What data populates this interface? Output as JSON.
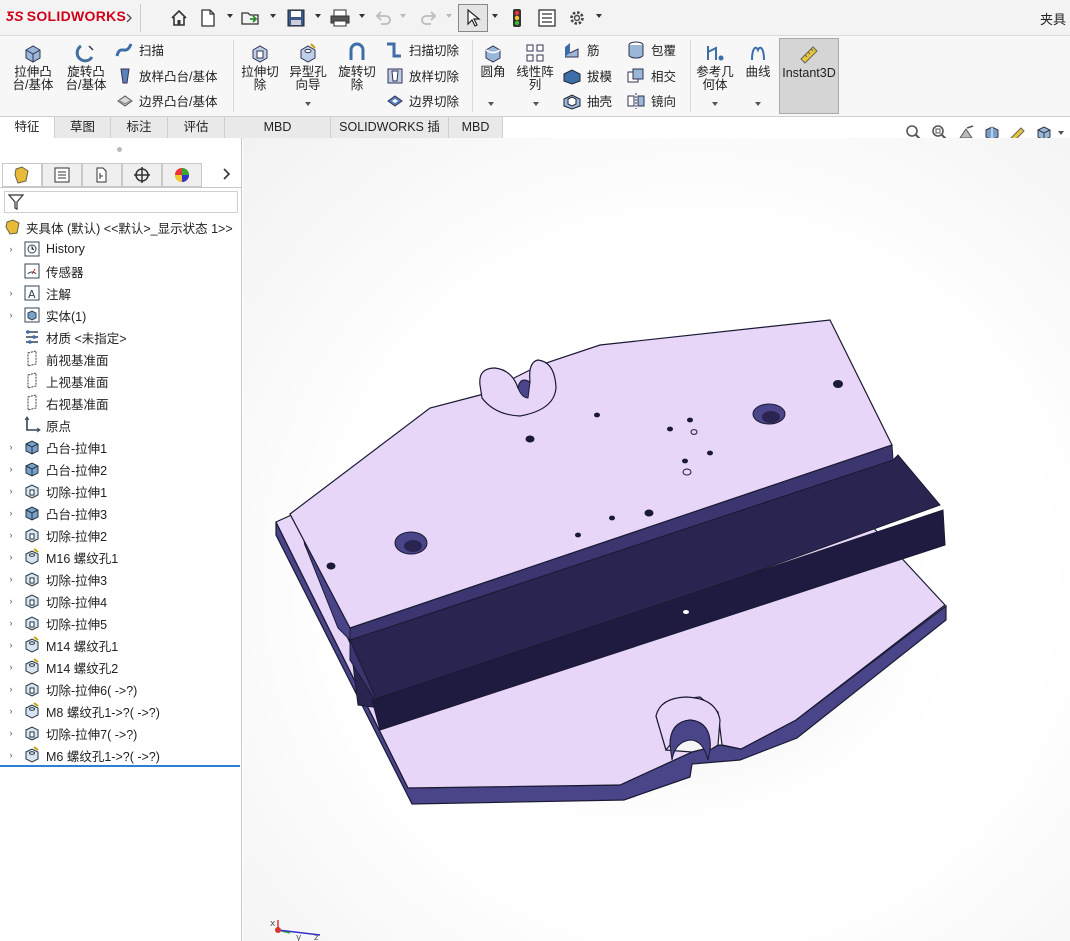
{
  "app": {
    "logo_ds": "ƼS",
    "logo_name": "SOLIDWORKS",
    "doc_title": "夹具"
  },
  "quick_access": [
    "home-icon",
    "new-document-icon",
    "open-icon",
    "save-icon",
    "print-icon",
    "undo-icon",
    "redo-icon",
    "select-icon",
    "rebuild-icon",
    "file-properties-icon",
    "options-icon"
  ],
  "ribbon": {
    "boss_extrude": "拉伸凸\n台/基体",
    "revolve_boss": "旋转凸\n台/基体",
    "sweep": "扫描",
    "loft_boss": "放样凸台/基体",
    "boundary_boss": "边界凸台/基体",
    "extrude_cut": "拉伸切\n除",
    "hole_wizard": "异型孔\n向导",
    "revolve_cut": "旋转切\n除",
    "sweep_cut": "扫描切除",
    "loft_cut": "放样切除",
    "boundary_cut": "边界切除",
    "fillet": "圆角",
    "linear_pattern": "线性阵\n列",
    "rib": "筋",
    "draft": "拔模",
    "shell": "抽壳",
    "wrap": "包覆",
    "intersect": "相交",
    "mirror": "镜向",
    "ref_geometry": "参考几\n何体",
    "curves": "曲线",
    "instant3d": "Instant3D"
  },
  "tabs": [
    "特征",
    "草图",
    "标注",
    "评估",
    "MBD Dimensions",
    "SOLIDWORKS 插件",
    "MBD"
  ],
  "tree": {
    "root": "夹具体 (默认) <<默认>_显示状态 1>>",
    "items": [
      {
        "label": "History",
        "icon": "history-icon",
        "expand": "›"
      },
      {
        "label": "传感器",
        "icon": "sensor-icon",
        "expand": ""
      },
      {
        "label": "注解",
        "icon": "annotation-icon",
        "expand": "›"
      },
      {
        "label": "实体(1)",
        "icon": "solid-bodies-icon",
        "expand": "›"
      },
      {
        "label": "材质 <未指定>",
        "icon": "material-icon",
        "expand": ""
      },
      {
        "label": "前视基准面",
        "icon": "plane-icon",
        "expand": ""
      },
      {
        "label": "上视基准面",
        "icon": "plane-icon",
        "expand": ""
      },
      {
        "label": "右视基准面",
        "icon": "plane-icon",
        "expand": ""
      },
      {
        "label": "原点",
        "icon": "origin-icon",
        "expand": ""
      },
      {
        "label": "凸台-拉伸1",
        "icon": "extrude-feature-icon",
        "expand": "›"
      },
      {
        "label": "凸台-拉伸2",
        "icon": "extrude-feature-icon",
        "expand": "›"
      },
      {
        "label": "切除-拉伸1",
        "icon": "cut-feature-icon",
        "expand": "›"
      },
      {
        "label": "凸台-拉伸3",
        "icon": "extrude-feature-icon",
        "expand": "›"
      },
      {
        "label": "切除-拉伸2",
        "icon": "cut-feature-icon",
        "expand": "›"
      },
      {
        "label": "M16 螺纹孔1",
        "icon": "hole-feature-icon",
        "expand": "›"
      },
      {
        "label": "切除-拉伸3",
        "icon": "cut-feature-icon",
        "expand": "›"
      },
      {
        "label": "切除-拉伸4",
        "icon": "cut-feature-icon",
        "expand": "›"
      },
      {
        "label": "切除-拉伸5",
        "icon": "cut-feature-icon",
        "expand": "›"
      },
      {
        "label": "M14 螺纹孔1",
        "icon": "hole-feature-icon",
        "expand": "›"
      },
      {
        "label": "M14 螺纹孔2",
        "icon": "hole-feature-icon",
        "expand": "›"
      },
      {
        "label": "切除-拉伸6( ->?)",
        "icon": "cut-feature-icon",
        "expand": "›"
      },
      {
        "label": "M8 螺纹孔1->?( ->?)",
        "icon": "hole-feature-icon",
        "expand": "›"
      },
      {
        "label": "切除-拉伸7( ->?)",
        "icon": "cut-feature-icon",
        "expand": "›"
      },
      {
        "label": "M6 螺纹孔1->?( ->?)",
        "icon": "hole-feature-icon",
        "expand": "›"
      }
    ]
  },
  "viewport": {
    "part_color": "#e7d6f8",
    "edge_color": "#1a1a33",
    "side_color": "#4a4488",
    "dark_face": "#2a2550",
    "triad": {
      "x": "x",
      "y": "y",
      "z": "z"
    }
  }
}
